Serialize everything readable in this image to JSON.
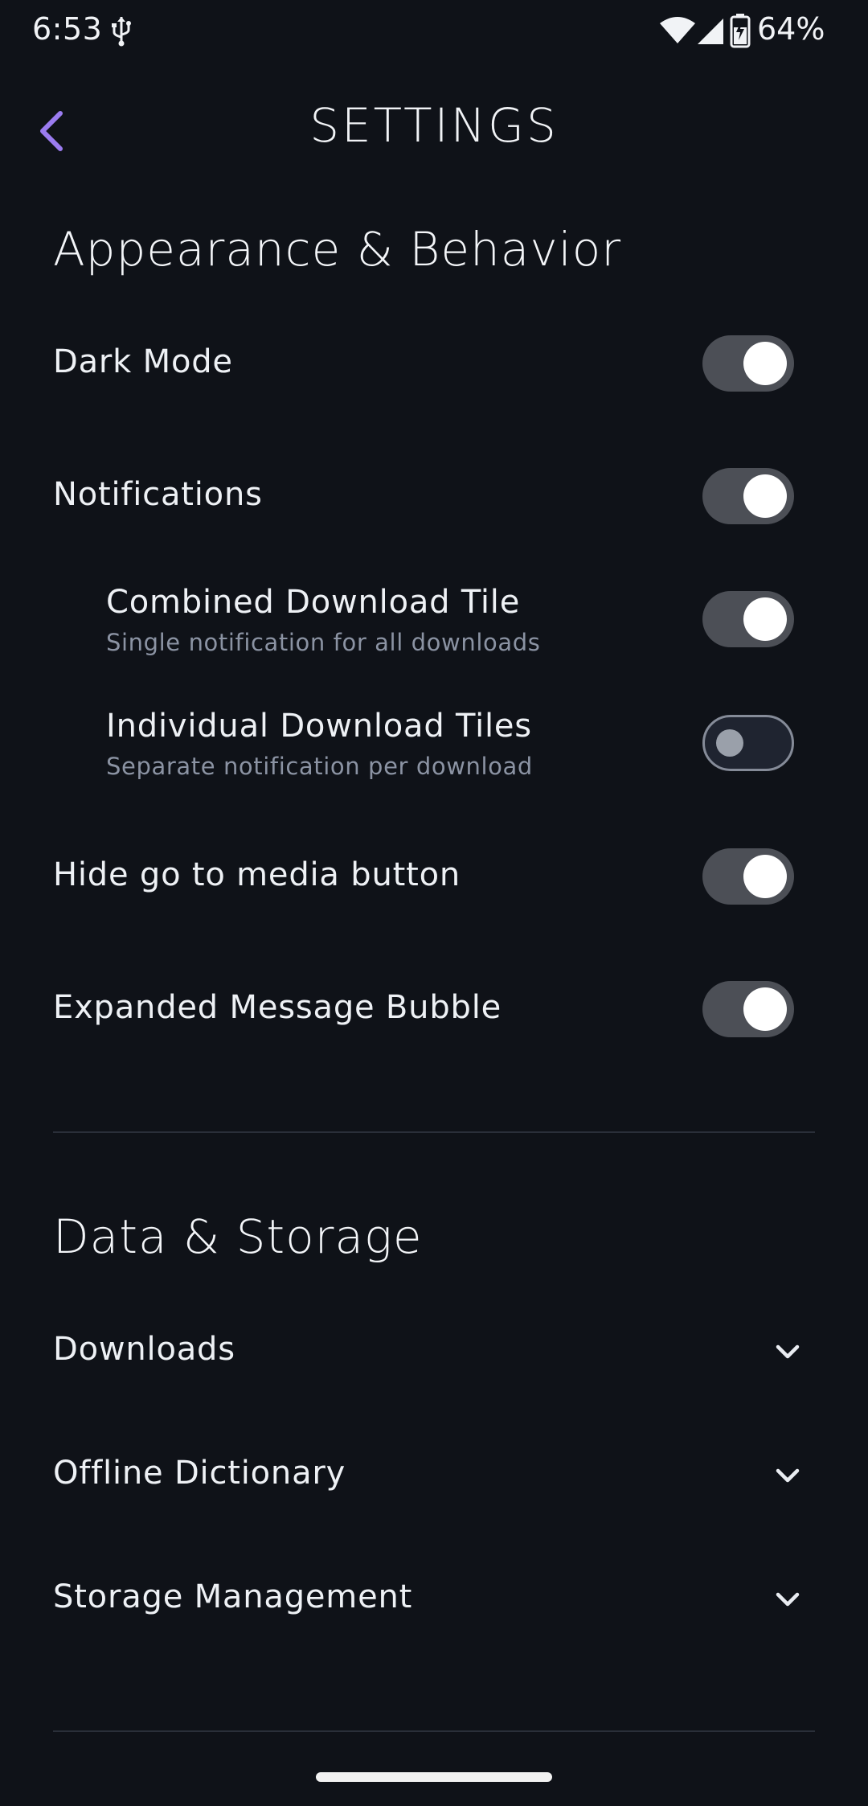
{
  "status_bar": {
    "time": "6:53",
    "battery_percent": "64%"
  },
  "header": {
    "title": "SETTINGS"
  },
  "appearance": {
    "section_title": "Appearance & Behavior",
    "dark_mode": {
      "label": "Dark Mode",
      "enabled": true
    },
    "notifications": {
      "label": "Notifications",
      "enabled": true
    },
    "combined_download_tile": {
      "label": "Combined Download Tile",
      "description": "Single notification for all downloads",
      "enabled": true
    },
    "individual_download_tiles": {
      "label": "Individual Download Tiles",
      "description": "Separate notification per download",
      "enabled": false
    },
    "hide_go_to_media": {
      "label": "Hide go to media button",
      "enabled": true
    },
    "expanded_message_bubble": {
      "label": "Expanded Message Bubble",
      "enabled": true
    }
  },
  "data_storage": {
    "section_title": "Data & Storage",
    "items": [
      {
        "label": "Downloads"
      },
      {
        "label": "Offline Dictionary"
      },
      {
        "label": "Storage Management"
      }
    ]
  },
  "colors": {
    "background": "#0f1218",
    "accent": "#9b7cf0",
    "toggle_on_track": "#4c4f56",
    "toggle_off_track": "#1f2430"
  }
}
